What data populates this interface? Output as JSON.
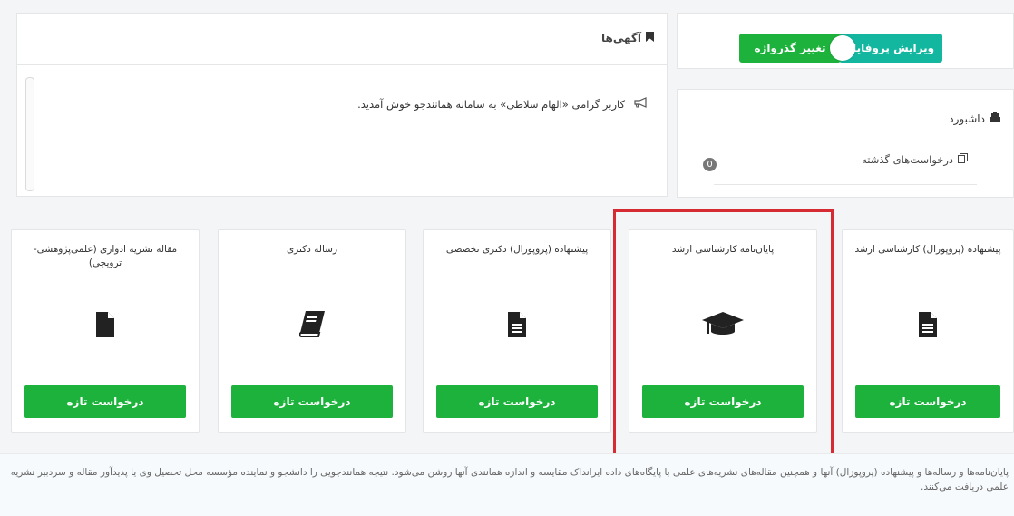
{
  "announcements": {
    "title": "آگهی‌ها",
    "message": "کاربر گرامی «الهام سلاطی» به سامانه همانندجو خوش آمدید."
  },
  "profile": {
    "edit_label": "ویرایش پروفایل",
    "change_password_label": "تغییر گذرواژه"
  },
  "dashboard": {
    "title": "داشبورد",
    "past_requests_label": "درخواست‌های گذشته",
    "past_requests_count": "0"
  },
  "cards": [
    {
      "title": "پیشنهاده (پروپوزال) کارشناسی ارشد",
      "icon": "file-text-icon",
      "button": "درخواست تازه"
    },
    {
      "title": "پایان‌نامه کارشناسی ارشد",
      "icon": "graduation-cap-icon",
      "button": "درخواست تازه"
    },
    {
      "title": "پیشنهاده (پروپوزال) دکتری تخصصی",
      "icon": "file-text-icon",
      "button": "درخواست تازه"
    },
    {
      "title": "رساله دکتری",
      "icon": "book-icon",
      "button": "درخواست تازه"
    },
    {
      "title": "مقاله نشریه ادواری (علمی‌پژوهشی-ترویجی)",
      "icon": "file-icon",
      "button": "درخواست تازه"
    }
  ],
  "info": {
    "text": "پایان‌نامه‌ها و رساله‌ها و پیشنهاده (پروپوزال) آنها و همچنین مقاله‌های نشریه‌های علمی با پایگاه‌های داده ایرانداک مقایسه و اندازه همانندی آنها روشن می‌شود. نتیجه همانندجویی را دانشجو و نماینده مؤسسه محل تحصیل وی یا پدیدآور مقاله و سردبیر نشریه علمی دریافت می‌کنند."
  },
  "colors": {
    "green": "#1db23c",
    "teal": "#13b7a0",
    "highlight": "#d62b33"
  }
}
